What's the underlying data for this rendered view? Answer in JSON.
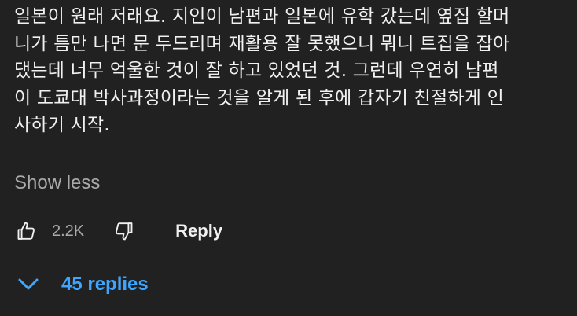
{
  "comment": {
    "lines": [
      "일본이 원래 저래요. 지인이 남편과 일본에 유학 갔는데 옆집 할머",
      "니가 틈만 나면 문 두드리며 재활용 잘 못했으니 뭐니 트집을 잡아",
      "댔는데 너무 억울한 것이 잘 하고 있었던 것. 그런데 우연히 남편",
      "이 도쿄대 박사과정이라는 것을 알게 된 후에 갑자기 친절하게 인",
      "사하기 시작."
    ]
  },
  "show_less_label": "Show less",
  "actions": {
    "like_count": "2.2K",
    "reply_label": "Reply"
  },
  "replies": {
    "label": "45 replies"
  },
  "colors": {
    "background": "#212121",
    "text": "#f1f1f1",
    "secondary_text": "#aaaaaa",
    "link": "#3ea6ff"
  },
  "icons": {
    "like": "thumbs-up-icon",
    "dislike": "thumbs-down-icon",
    "expand": "chevron-down-icon"
  }
}
